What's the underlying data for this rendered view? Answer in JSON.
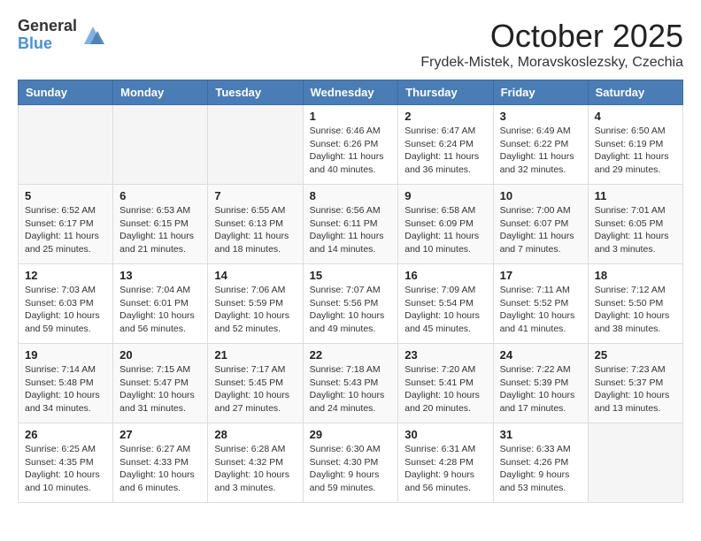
{
  "header": {
    "logo_general": "General",
    "logo_blue": "Blue",
    "month_title": "October 2025",
    "location": "Frydek-Mistek, Moravskoslezsky, Czechia"
  },
  "weekdays": [
    "Sunday",
    "Monday",
    "Tuesday",
    "Wednesday",
    "Thursday",
    "Friday",
    "Saturday"
  ],
  "weeks": [
    [
      {
        "day": "",
        "info": ""
      },
      {
        "day": "",
        "info": ""
      },
      {
        "day": "",
        "info": ""
      },
      {
        "day": "1",
        "info": "Sunrise: 6:46 AM\nSunset: 6:26 PM\nDaylight: 11 hours\nand 40 minutes."
      },
      {
        "day": "2",
        "info": "Sunrise: 6:47 AM\nSunset: 6:24 PM\nDaylight: 11 hours\nand 36 minutes."
      },
      {
        "day": "3",
        "info": "Sunrise: 6:49 AM\nSunset: 6:22 PM\nDaylight: 11 hours\nand 32 minutes."
      },
      {
        "day": "4",
        "info": "Sunrise: 6:50 AM\nSunset: 6:19 PM\nDaylight: 11 hours\nand 29 minutes."
      }
    ],
    [
      {
        "day": "5",
        "info": "Sunrise: 6:52 AM\nSunset: 6:17 PM\nDaylight: 11 hours\nand 25 minutes."
      },
      {
        "day": "6",
        "info": "Sunrise: 6:53 AM\nSunset: 6:15 PM\nDaylight: 11 hours\nand 21 minutes."
      },
      {
        "day": "7",
        "info": "Sunrise: 6:55 AM\nSunset: 6:13 PM\nDaylight: 11 hours\nand 18 minutes."
      },
      {
        "day": "8",
        "info": "Sunrise: 6:56 AM\nSunset: 6:11 PM\nDaylight: 11 hours\nand 14 minutes."
      },
      {
        "day": "9",
        "info": "Sunrise: 6:58 AM\nSunset: 6:09 PM\nDaylight: 11 hours\nand 10 minutes."
      },
      {
        "day": "10",
        "info": "Sunrise: 7:00 AM\nSunset: 6:07 PM\nDaylight: 11 hours\nand 7 minutes."
      },
      {
        "day": "11",
        "info": "Sunrise: 7:01 AM\nSunset: 6:05 PM\nDaylight: 11 hours\nand 3 minutes."
      }
    ],
    [
      {
        "day": "12",
        "info": "Sunrise: 7:03 AM\nSunset: 6:03 PM\nDaylight: 10 hours\nand 59 minutes."
      },
      {
        "day": "13",
        "info": "Sunrise: 7:04 AM\nSunset: 6:01 PM\nDaylight: 10 hours\nand 56 minutes."
      },
      {
        "day": "14",
        "info": "Sunrise: 7:06 AM\nSunset: 5:59 PM\nDaylight: 10 hours\nand 52 minutes."
      },
      {
        "day": "15",
        "info": "Sunrise: 7:07 AM\nSunset: 5:56 PM\nDaylight: 10 hours\nand 49 minutes."
      },
      {
        "day": "16",
        "info": "Sunrise: 7:09 AM\nSunset: 5:54 PM\nDaylight: 10 hours\nand 45 minutes."
      },
      {
        "day": "17",
        "info": "Sunrise: 7:11 AM\nSunset: 5:52 PM\nDaylight: 10 hours\nand 41 minutes."
      },
      {
        "day": "18",
        "info": "Sunrise: 7:12 AM\nSunset: 5:50 PM\nDaylight: 10 hours\nand 38 minutes."
      }
    ],
    [
      {
        "day": "19",
        "info": "Sunrise: 7:14 AM\nSunset: 5:48 PM\nDaylight: 10 hours\nand 34 minutes."
      },
      {
        "day": "20",
        "info": "Sunrise: 7:15 AM\nSunset: 5:47 PM\nDaylight: 10 hours\nand 31 minutes."
      },
      {
        "day": "21",
        "info": "Sunrise: 7:17 AM\nSunset: 5:45 PM\nDaylight: 10 hours\nand 27 minutes."
      },
      {
        "day": "22",
        "info": "Sunrise: 7:18 AM\nSunset: 5:43 PM\nDaylight: 10 hours\nand 24 minutes."
      },
      {
        "day": "23",
        "info": "Sunrise: 7:20 AM\nSunset: 5:41 PM\nDaylight: 10 hours\nand 20 minutes."
      },
      {
        "day": "24",
        "info": "Sunrise: 7:22 AM\nSunset: 5:39 PM\nDaylight: 10 hours\nand 17 minutes."
      },
      {
        "day": "25",
        "info": "Sunrise: 7:23 AM\nSunset: 5:37 PM\nDaylight: 10 hours\nand 13 minutes."
      }
    ],
    [
      {
        "day": "26",
        "info": "Sunrise: 6:25 AM\nSunset: 4:35 PM\nDaylight: 10 hours\nand 10 minutes."
      },
      {
        "day": "27",
        "info": "Sunrise: 6:27 AM\nSunset: 4:33 PM\nDaylight: 10 hours\nand 6 minutes."
      },
      {
        "day": "28",
        "info": "Sunrise: 6:28 AM\nSunset: 4:32 PM\nDaylight: 10 hours\nand 3 minutes."
      },
      {
        "day": "29",
        "info": "Sunrise: 6:30 AM\nSunset: 4:30 PM\nDaylight: 9 hours\nand 59 minutes."
      },
      {
        "day": "30",
        "info": "Sunrise: 6:31 AM\nSunset: 4:28 PM\nDaylight: 9 hours\nand 56 minutes."
      },
      {
        "day": "31",
        "info": "Sunrise: 6:33 AM\nSunset: 4:26 PM\nDaylight: 9 hours\nand 53 minutes."
      },
      {
        "day": "",
        "info": ""
      }
    ]
  ]
}
